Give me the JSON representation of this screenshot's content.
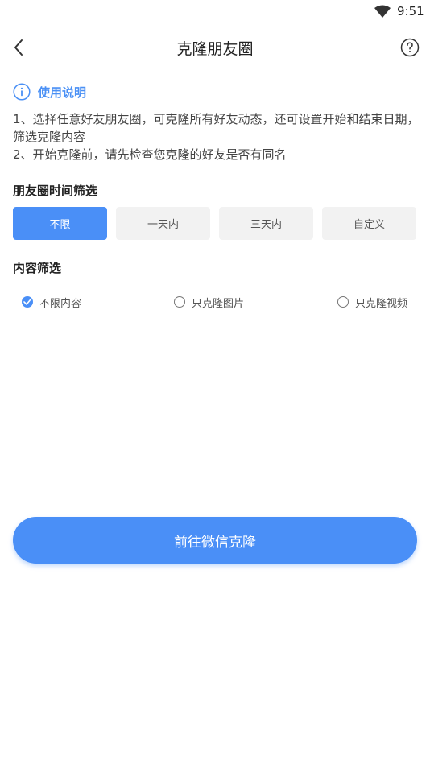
{
  "status_bar": {
    "time": "9:51"
  },
  "header": {
    "title": "克隆朋友圈"
  },
  "guide": {
    "title": "使用说明",
    "line1": "1、选择任意好友朋友圈，可克隆所有好友动态，还可设置开始和结束日期，筛选克隆内容",
    "line2": "2、开始克隆前，请先检查您克隆的好友是否有同名"
  },
  "time_filter": {
    "title": "朋友圈时间筛选",
    "options": [
      {
        "label": "不限",
        "selected": true
      },
      {
        "label": "一天内",
        "selected": false
      },
      {
        "label": "三天内",
        "selected": false
      },
      {
        "label": "自定义",
        "selected": false
      }
    ]
  },
  "content_filter": {
    "title": "内容筛选",
    "options": [
      {
        "label": "不限内容",
        "selected": true
      },
      {
        "label": "只克隆图片",
        "selected": false
      },
      {
        "label": "只克隆视频",
        "selected": false
      }
    ]
  },
  "action": {
    "label": "前往微信克隆"
  },
  "colors": {
    "accent": "#4a8ff7",
    "chip_bg": "#f2f2f2",
    "text": "#333333"
  },
  "icons": {
    "back": "chevron-left-icon",
    "help": "question-circle-icon",
    "info": "info-circle-icon",
    "wifi": "wifi-icon"
  }
}
